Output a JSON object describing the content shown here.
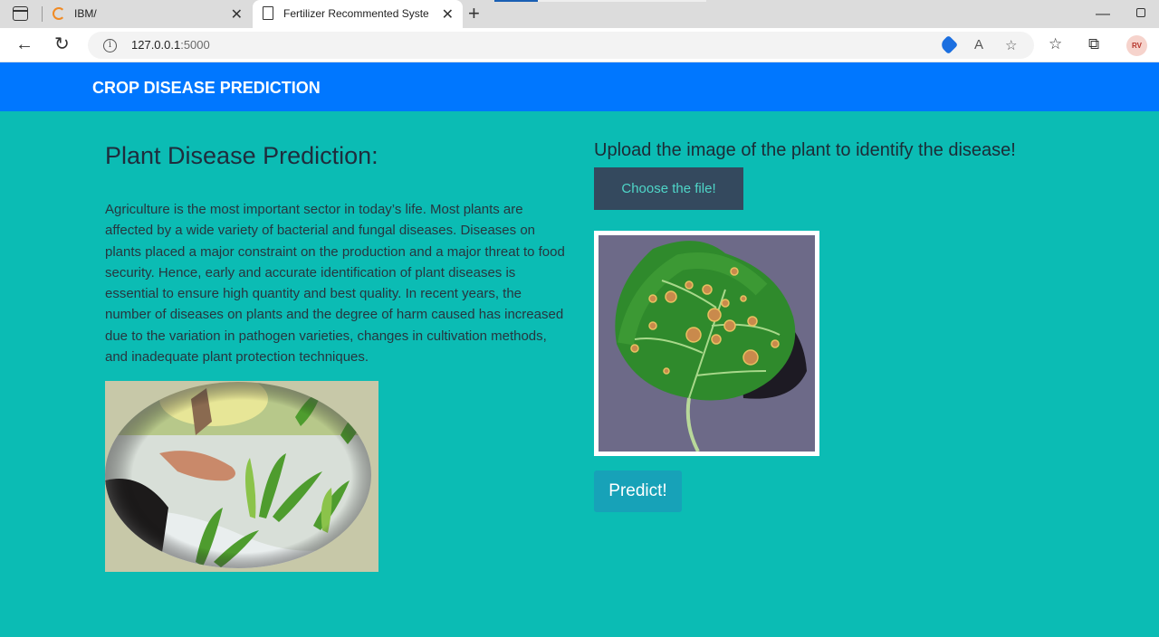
{
  "browser": {
    "tabs": [
      {
        "title": "IBM/",
        "favicon": "ibm-loading-icon"
      },
      {
        "title": "Fertilizer Recommented System a",
        "favicon": "document-icon"
      }
    ],
    "address": {
      "host": "127.0.0.1",
      "port": ":5000"
    },
    "avatar_initials": "RV"
  },
  "navbar": {
    "brand": "CROP DISEASE PREDICTION",
    "color": "#0077ff"
  },
  "left": {
    "heading": "Plant Disease Prediction:",
    "description": "Agriculture is the most important sector in today’s life. Most plants are affected by a wide variety of bacterial and fungal diseases. Diseases on plants placed a major constraint on the production and a major threat to food security. Hence, early and accurate identification of plant diseases is essential to ensure high quantity and best quality. In recent years, the number of diseases on plants and the degree of harm caused has increased due to the variation in pathogen varieties, changes in cultivation methods, and inadequate plant protection techniques."
  },
  "right": {
    "upload_label": "Upload the image of the plant to identify the disease!",
    "choose_button": "Choose the file!",
    "predict_button": "Predict!"
  },
  "colors": {
    "page_background": "#0bbcb4",
    "choose_button": "#34495e",
    "predict_button": "#17a2b8"
  }
}
